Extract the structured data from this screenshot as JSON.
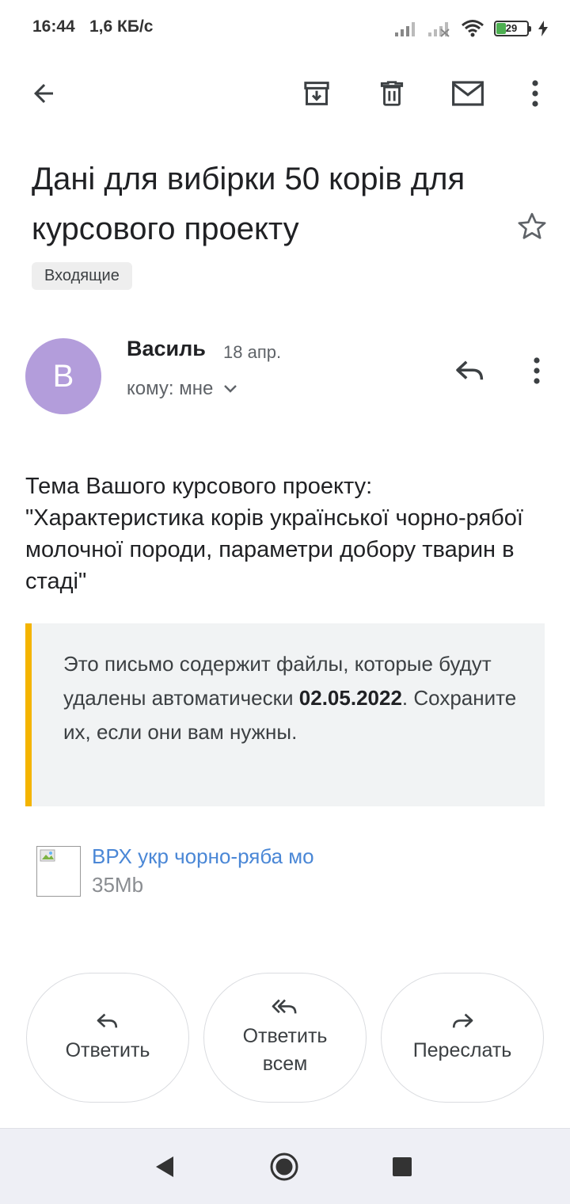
{
  "status_bar": {
    "time": "16:44",
    "network_speed": "1,6 КБ/с",
    "battery_level": "29",
    "battery_fraction": 0.29
  },
  "toolbar": {
    "back_icon": "arrow-back-icon",
    "archive_icon": "archive-icon",
    "delete_icon": "trash-icon",
    "mark_unread_icon": "mail-icon",
    "more_icon": "more-vert-icon"
  },
  "message": {
    "subject": "Дані для вибірки 50 корів для курсового проекту",
    "label": "Входящие",
    "sender": {
      "initial": "В",
      "name": "Василь",
      "date": "18 апр.",
      "recipient": "кому: мне",
      "avatar_color": "#b39ddb"
    },
    "body": "Тема Вашого курсового проекту: \"Характеристика корів української чорно-рябої молочної породи, параметри добору тварин в стаді\"",
    "notice": {
      "text_before": "Это письмо содержит файлы, которые будут удалены автоматически ",
      "date": "02.05.2022",
      "text_after": ". Сохраните их, если они вам нужны."
    },
    "attachment": {
      "name": "ВРХ укр чорно-ряба мо",
      "size": "35Mb"
    }
  },
  "actions": {
    "reply": "Ответить",
    "reply_all": "Ответить всем",
    "forward": "Переслать"
  },
  "colors": {
    "accent_notice_bar": "#f4b400",
    "link": "#4a87d6"
  }
}
